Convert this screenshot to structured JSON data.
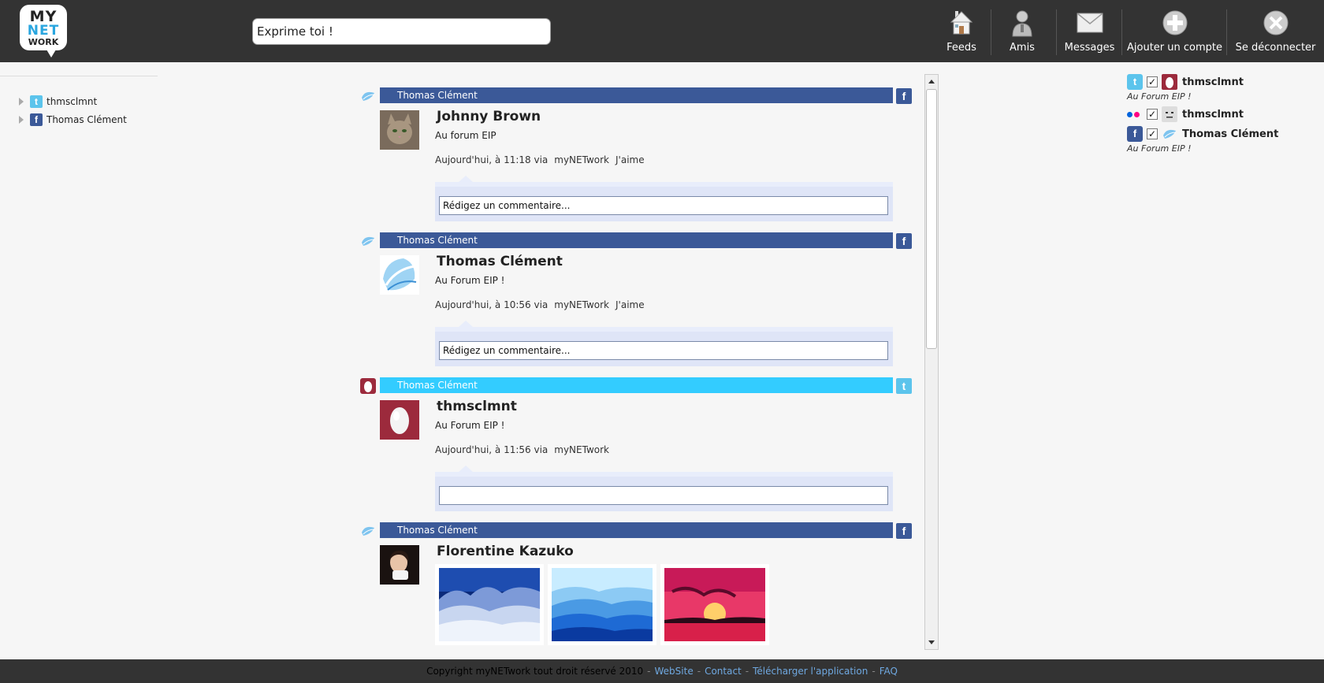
{
  "app": {
    "logo_lines": [
      "MY",
      "NET",
      "WORK"
    ]
  },
  "header": {
    "status_placeholder": "",
    "status_value": "Exprime toi !",
    "nav": [
      {
        "label": "Feeds",
        "icon": "house-icon"
      },
      {
        "label": "Amis",
        "icon": "person-icon"
      },
      {
        "label": "Messages",
        "icon": "envelope-icon"
      },
      {
        "label": "Ajouter un compte",
        "icon": "plus-circle-icon"
      },
      {
        "label": "Se déconnecter",
        "icon": "close-circle-icon"
      }
    ]
  },
  "sidebar": {
    "accounts": [
      {
        "network": "twitter",
        "label": "thmsclmnt"
      },
      {
        "network": "facebook",
        "label": "Thomas Clément"
      }
    ]
  },
  "feed": {
    "posts": [
      {
        "network": "facebook",
        "account": "Thomas Clément",
        "author": "Johnny Brown",
        "message": "Au forum EIP",
        "time": "Aujourd'hui, à 11:18 via",
        "via": "myNETwork",
        "like": "J'aime",
        "comment_placeholder": "Rédigez un commentaire..."
      },
      {
        "network": "facebook",
        "account": "Thomas Clément",
        "author": "Thomas Clément",
        "message": "Au Forum EIP !",
        "time": "Aujourd'hui, à 10:56 via",
        "via": "myNETwork",
        "like": "J'aime",
        "comment_placeholder": "Rédigez un commentaire..."
      },
      {
        "network": "twitter",
        "account": "Thomas Clément",
        "author": "thmsclmnt",
        "message": "Au Forum EIP !",
        "time": "Aujourd'hui, à 11:56 via",
        "via": "myNETwork",
        "like": "",
        "comment_placeholder": ""
      },
      {
        "network": "facebook",
        "account": "Thomas Clément",
        "author": "Florentine Kazuko",
        "photos": [
          "snowy-forest",
          "blue-mountains",
          "red-sunset"
        ]
      }
    ]
  },
  "right_panel": {
    "entries": [
      {
        "networks": [
          "twitter"
        ],
        "checked": true,
        "name": "thmsclmnt",
        "status": "Au Forum EIP !"
      },
      {
        "networks": [
          "flickr"
        ],
        "checked": true,
        "name": "thmsclmnt",
        "status": ""
      },
      {
        "networks": [
          "facebook"
        ],
        "checked": true,
        "name": "Thomas Clément",
        "status": "Au Forum EIP !"
      }
    ]
  },
  "footer": {
    "copyright": "Copyright myNETwork tout droit réservé 2010",
    "links": [
      "WebSite",
      "Contact",
      "Télécharger l'application",
      "FAQ"
    ]
  },
  "colors": {
    "topbar": "#333333",
    "facebook": "#3b5998",
    "twitter": "#33ccff",
    "link": "#6fa8e0",
    "comment_bg": "#dfe5f7"
  }
}
